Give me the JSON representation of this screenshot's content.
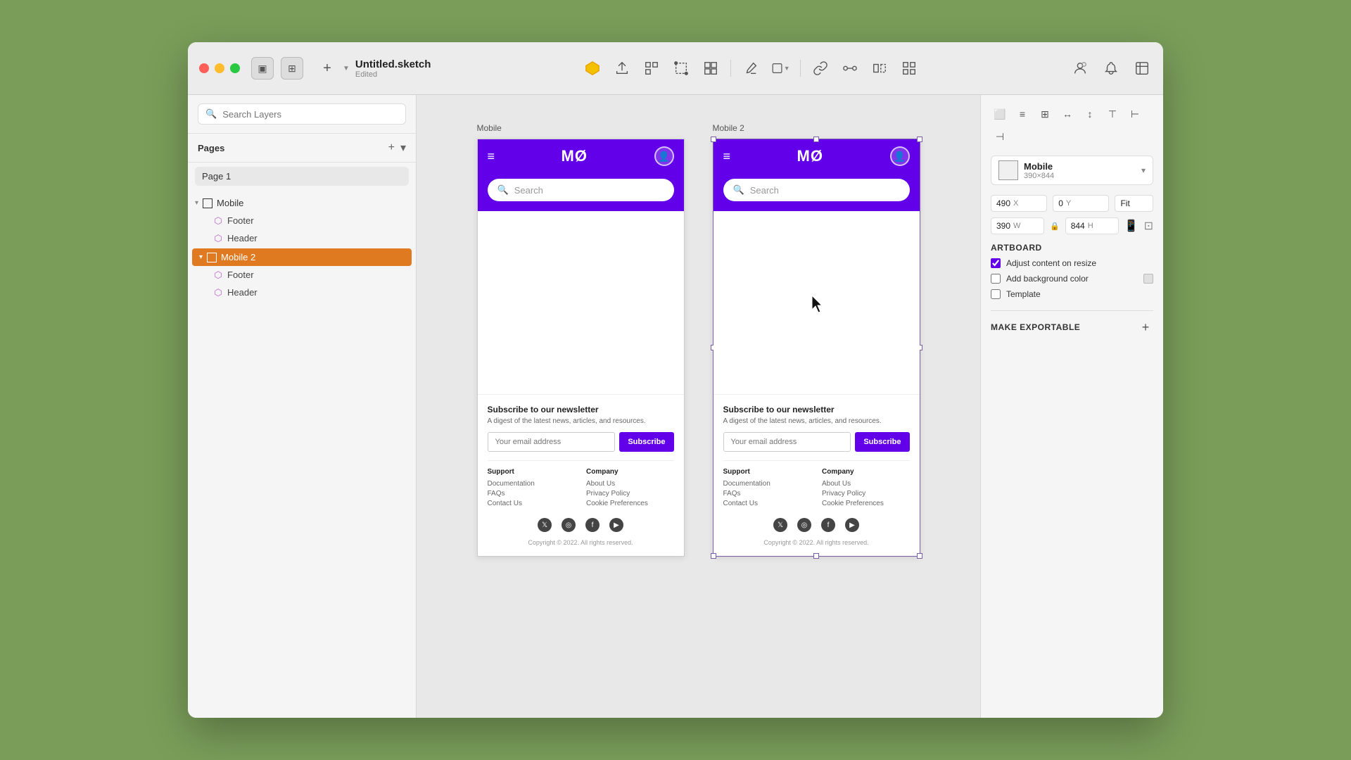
{
  "window": {
    "title": "Untitled.sketch",
    "status": "Edited"
  },
  "sidebar": {
    "search_placeholder": "Search Layers",
    "pages_title": "Pages",
    "page_item": "Page 1",
    "layers": [
      {
        "id": "mobile",
        "label": "Mobile",
        "type": "artboard",
        "expanded": true,
        "selected": false,
        "children": [
          {
            "id": "footer1",
            "label": "Footer",
            "type": "component"
          },
          {
            "id": "header1",
            "label": "Header",
            "type": "component"
          }
        ]
      },
      {
        "id": "mobile2",
        "label": "Mobile 2",
        "type": "artboard",
        "expanded": true,
        "selected": true,
        "children": [
          {
            "id": "footer2",
            "label": "Footer",
            "type": "component"
          },
          {
            "id": "header2",
            "label": "Header",
            "type": "component"
          }
        ]
      }
    ]
  },
  "canvas": {
    "artboard1": {
      "label": "Mobile",
      "header": {
        "logo": "MØ",
        "search_placeholder": "Search"
      },
      "footer": {
        "newsletter_title": "Subscribe to our newsletter",
        "newsletter_sub": "A digest of the latest news, articles, and resources.",
        "email_placeholder": "Your email address",
        "subscribe_label": "Subscribe",
        "support_title": "Support",
        "support_links": [
          "Documentation",
          "FAQs",
          "Contact Us"
        ],
        "company_title": "Company",
        "company_links": [
          "About Us",
          "Privacy Policy",
          "Cookie Preferences"
        ],
        "copyright": "Copyright © 2022. All rights reserved."
      }
    },
    "artboard2": {
      "label": "Mobile 2",
      "header": {
        "logo": "MØ",
        "search_placeholder": "Search"
      },
      "footer": {
        "newsletter_title": "Subscribe to our newsletter",
        "newsletter_sub": "A digest of the latest news, articles, and resources.",
        "email_placeholder": "Your email address",
        "subscribe_label": "Subscribe",
        "support_title": "Support",
        "support_links": [
          "Documentation",
          "FAQs",
          "Contact Us"
        ],
        "company_title": "Company",
        "company_links": [
          "About Us",
          "Privacy Policy",
          "Cookie Preferences"
        ],
        "copyright": "Copyright © 2022. All rights reserved."
      }
    }
  },
  "right_panel": {
    "artboard_name": "Mobile",
    "artboard_dims": "390×844",
    "x_label": "X",
    "x_value": "490",
    "y_label": "Y",
    "y_value": "0",
    "fit_label": "Fit",
    "w_label": "W",
    "w_value": "390",
    "h_label": "H",
    "h_value": "844",
    "artboard_section": "Artboard",
    "adjust_label": "Adjust content on resize",
    "bg_color_label": "Add background color",
    "template_label": "Template",
    "make_exportable": "MAKE EXPORTABLE"
  }
}
